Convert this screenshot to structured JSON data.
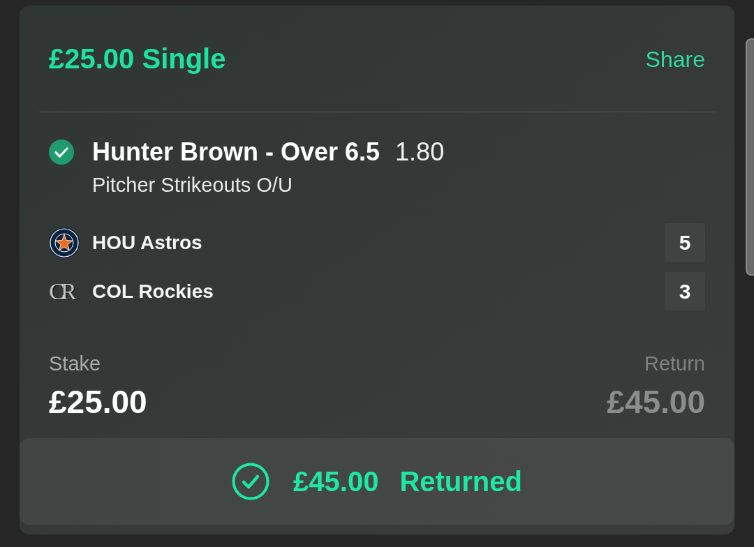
{
  "bet": {
    "title": "£25.00 Single",
    "share_link": "Share"
  },
  "selection": {
    "won": true,
    "name": "Hunter Brown - Over 6.5",
    "odds": "1.80",
    "market": "Pitcher Strikeouts O/U"
  },
  "teams": [
    {
      "name": "HOU Astros",
      "score": "5"
    },
    {
      "name": "COL Rockies",
      "logo_monogram": "CR",
      "score": "3"
    }
  ],
  "stake": {
    "label": "Stake",
    "value": "£25.00"
  },
  "return": {
    "label": "Return",
    "value": "£45.00"
  },
  "settlement": {
    "returned": true,
    "amount": "£45.00",
    "label": "Returned"
  }
}
